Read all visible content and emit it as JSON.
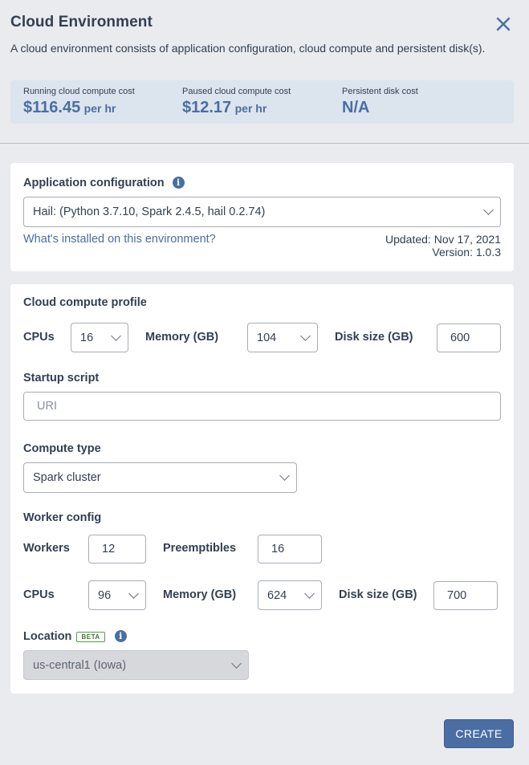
{
  "header": {
    "title": "Cloud Environment",
    "subtitle": "A cloud environment consists of application configuration, cloud compute and persistent disk(s)."
  },
  "costs": {
    "running": {
      "label": "Running cloud compute cost",
      "value": "$116.45",
      "unit": "per hr"
    },
    "paused": {
      "label": "Paused cloud compute cost",
      "value": "$12.17",
      "unit": "per hr"
    },
    "disk": {
      "label": "Persistent disk cost",
      "value": "N/A"
    }
  },
  "app_config": {
    "label": "Application configuration",
    "selected": "Hail: (Python 3.7.10, Spark 2.4.5, hail 0.2.74)",
    "link": "What's installed on this environment?",
    "updated": "Updated: Nov 17, 2021",
    "version": "Version: 1.0.3"
  },
  "compute_profile": {
    "label": "Cloud compute profile",
    "cpus_label": "CPUs",
    "cpus_value": "16",
    "memory_label": "Memory (GB)",
    "memory_value": "104",
    "disk_label": "Disk size (GB)",
    "disk_value": "600"
  },
  "startup": {
    "label": "Startup script",
    "placeholder": "URI"
  },
  "compute_type": {
    "label": "Compute type",
    "selected": "Spark cluster"
  },
  "worker_config": {
    "label": "Worker config",
    "workers_label": "Workers",
    "workers_value": "12",
    "preemptibles_label": "Preemptibles",
    "preemptibles_value": "16",
    "cpus_label": "CPUs",
    "cpus_value": "96",
    "memory_label": "Memory (GB)",
    "memory_value": "624",
    "disk_label": "Disk size (GB)",
    "disk_value": "700"
  },
  "location": {
    "label": "Location",
    "badge": "BETA",
    "selected": "us-central1 (Iowa)"
  },
  "footer": {
    "create_label": "CREATE"
  },
  "colors": {
    "accent": "#4a6ea3",
    "background": "#e9ebee",
    "cost_box": "#dce4ee"
  }
}
